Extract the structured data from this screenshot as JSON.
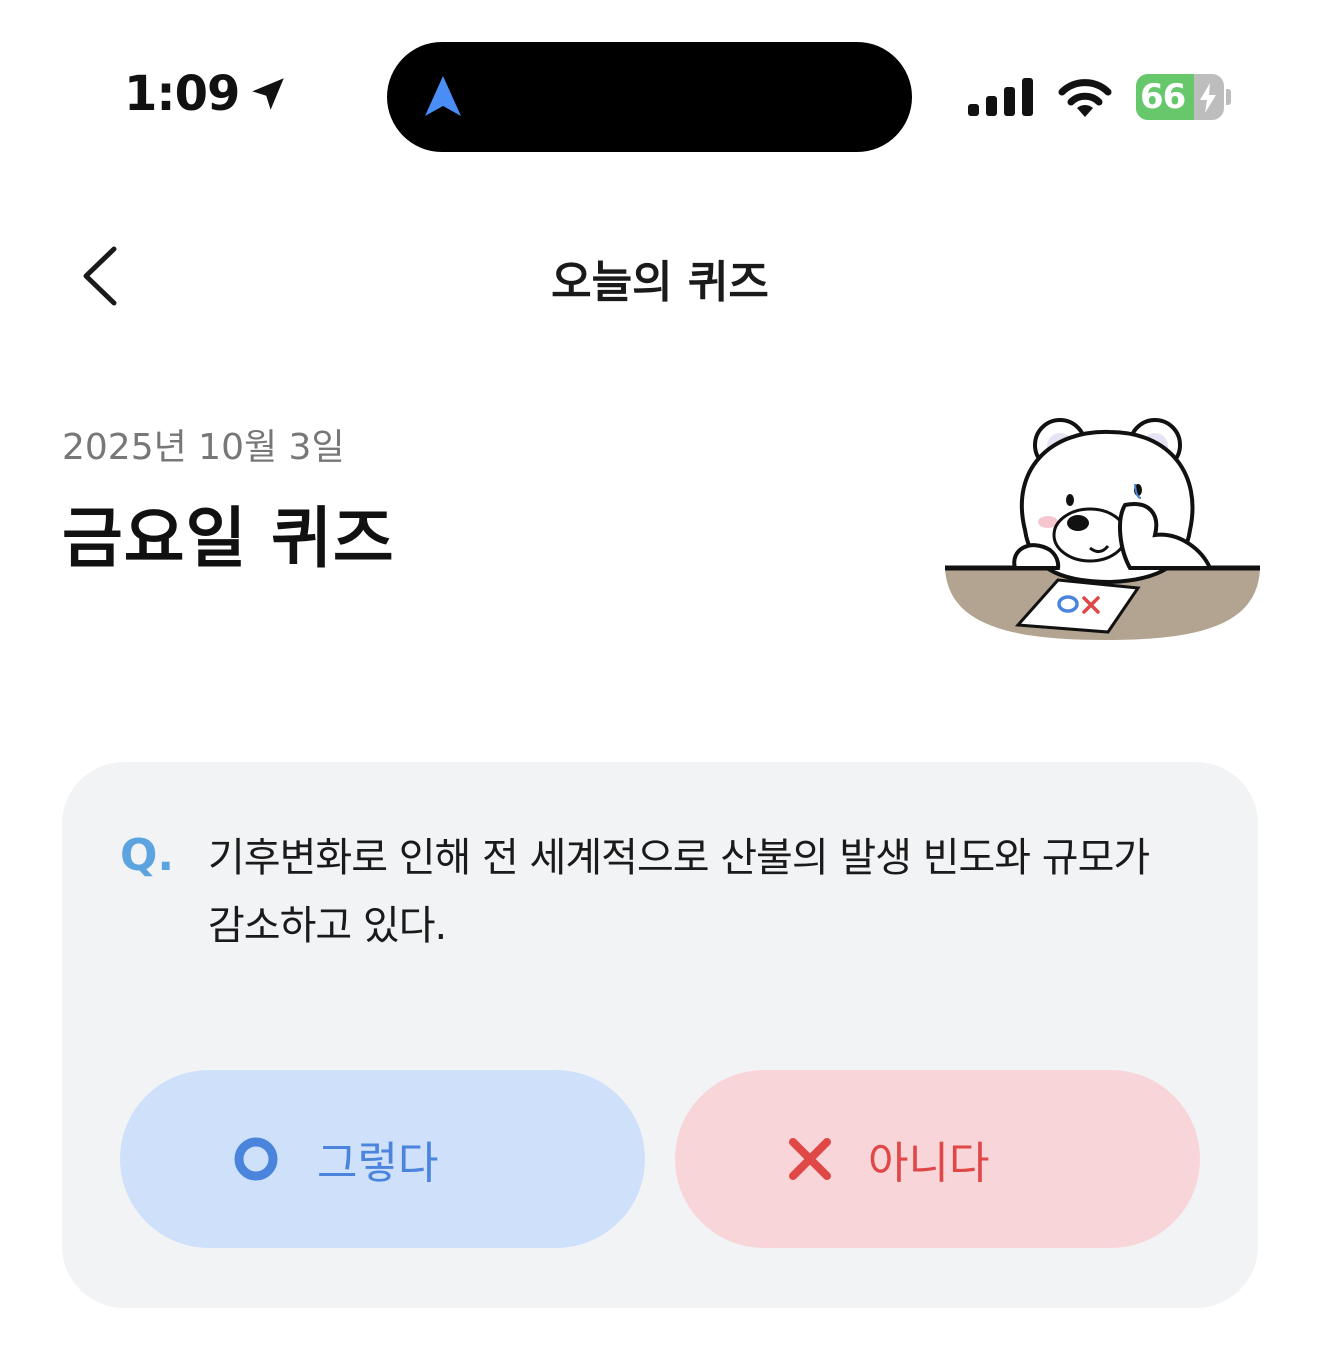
{
  "status_bar": {
    "time": "1:09",
    "battery": "66"
  },
  "nav": {
    "title": "오늘의 퀴즈"
  },
  "header": {
    "date": "2025년 10월 3일",
    "title": "금요일 퀴즈"
  },
  "quiz": {
    "q_marker": "Q.",
    "question": "기후변화로 인해 전 세계적으로 산불의 발생 빈도와 규모가 감소하고 있다.",
    "options": [
      {
        "label": "그렇다",
        "icon": "circle-o-icon",
        "color": "#4a84dc"
      },
      {
        "label": "아니다",
        "icon": "x-icon",
        "color": "#e04848"
      }
    ]
  },
  "colors": {
    "card_bg": "#f2f3f5",
    "yes_bg": "#cfe0fb",
    "no_bg": "#f8d5d9",
    "q_marker": "#5ba4e0"
  }
}
